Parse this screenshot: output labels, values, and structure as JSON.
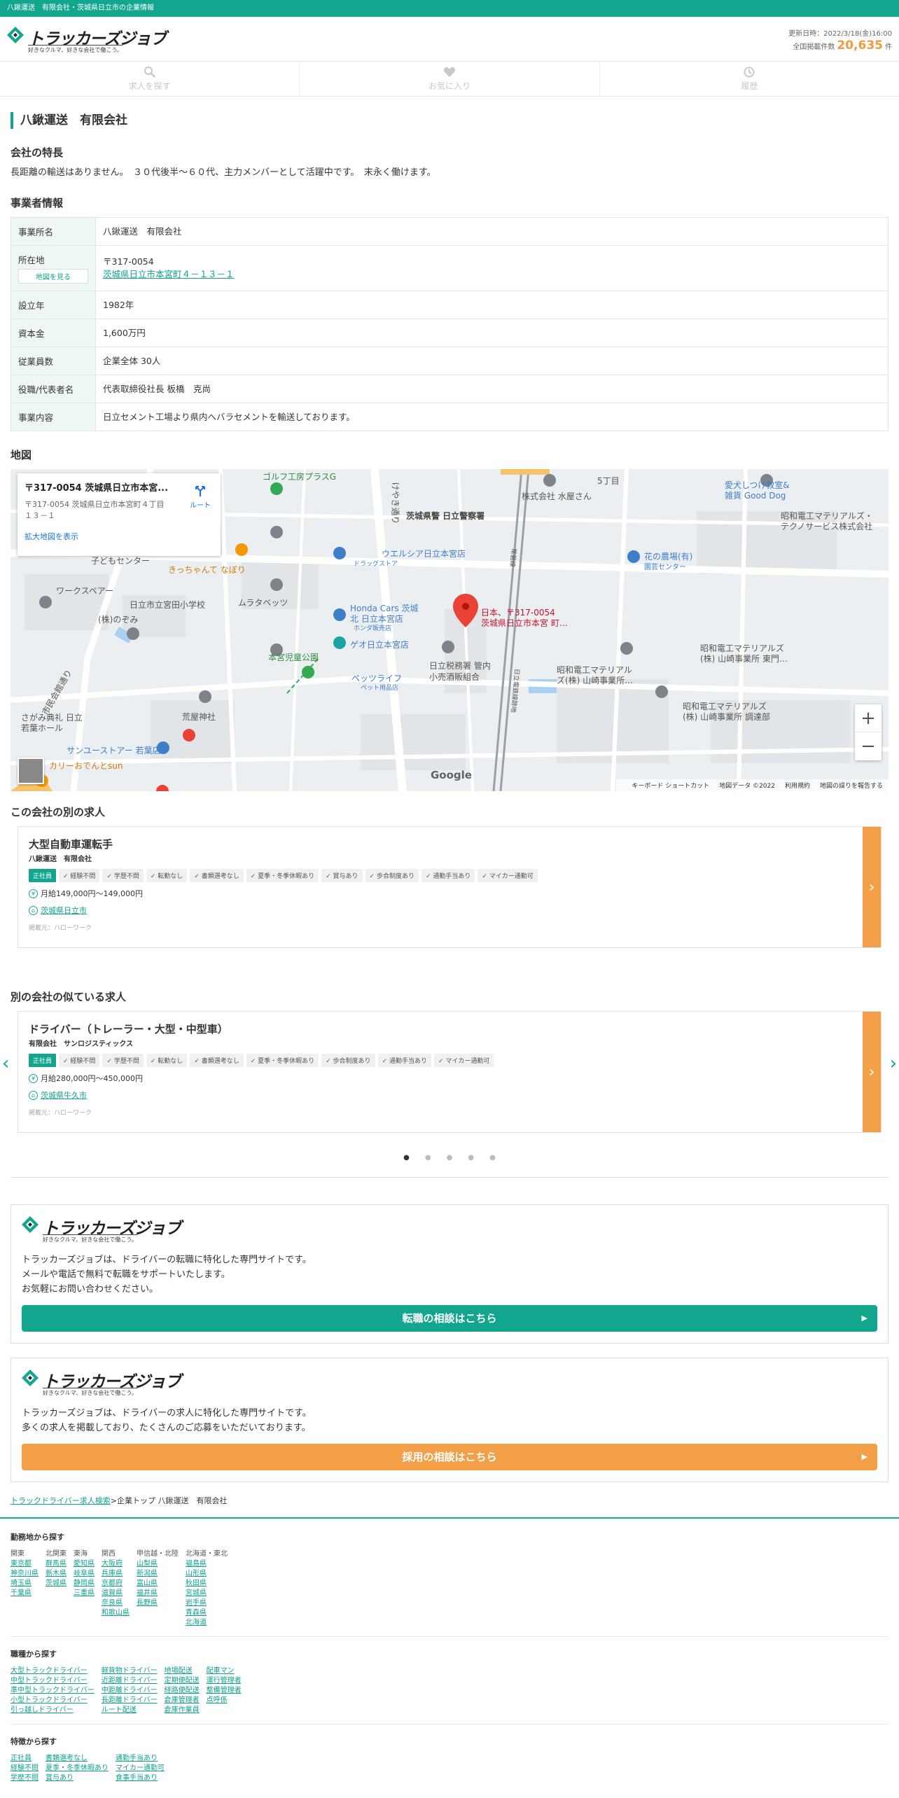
{
  "topbar": {
    "text": "八鍬運送　有限会社・茨城県日立市の企業情報"
  },
  "header": {
    "logo_text": "トラッカーズジョブ",
    "logo_tagline": "好きなクルマ、好きな会社で働こう。",
    "updated": "更新日時：2022/3/18(金)16:00",
    "total_label": "全国掲載件数",
    "total_count": "20,635",
    "total_unit": "件"
  },
  "nav": [
    {
      "label": "求人を探す",
      "icon": "search-icon"
    },
    {
      "label": "お気に入り",
      "icon": "heart-icon"
    },
    {
      "label": "履歴",
      "icon": "history-icon"
    }
  ],
  "page_title": "八鍬運送　有限会社",
  "features": {
    "heading": "会社の特長",
    "text": "長距離の輸送はありません。　３０代後半～６０代、主力メンバーとして活躍中です。　末永く働けます。"
  },
  "business": {
    "heading": "事業者情報",
    "map_button": "地図を見る",
    "rows": [
      {
        "label": "事業所名",
        "value": "八鍬運送　有限会社"
      },
      {
        "label": "所在地",
        "postal": "〒317-0054",
        "address": "茨城県日立市本宮町４－１３－１"
      },
      {
        "label": "設立年",
        "value": "1982年"
      },
      {
        "label": "資本金",
        "value": "1,600万円"
      },
      {
        "label": "従業員数",
        "value": "企業全体 30人"
      },
      {
        "label": "役職/代表者名",
        "value": "代表取締役社長 板橋　克尚"
      },
      {
        "label": "事業内容",
        "value": "日立セメント工場より県内へバラセメントを輸送しております。"
      }
    ]
  },
  "map": {
    "heading": "地図",
    "card_title": "〒317-0054 茨城県日立市本宮...",
    "card_address": "〒317-0054 茨城県日立市本宮町４丁目１３－１",
    "card_route": "ルート",
    "card_link": "拡大地図を表示",
    "pin_label_1": "日本、〒317-0054",
    "pin_label_2": "茨城県日立市本宮 町…",
    "zoom_in": "+",
    "zoom_out": "−",
    "google": "Google",
    "footer": [
      "キーボード ショートカット",
      "地図データ ©2022",
      "利用規約",
      "地図の誤りを報告する"
    ],
    "labels": {
      "golf": "ゴルフ工房プラスG",
      "police": "茨城県警 日立警察署",
      "uelsia": "ウエルシア日立本宮店",
      "drug": "ドラッグストア",
      "kodomo": "子どもセンター",
      "kichan": "きっちゃんて なぼり",
      "workspare": "ワークスペアー",
      "school": "日立市立宮田小学校",
      "muratabeppu": "ムラタベッツ",
      "nozomi": "(株)のぞみ",
      "honda1": "Honda Cars 茨城",
      "honda2": "北 日立本宮店",
      "honda3": "ホンダ販売店",
      "geo": "ゲオ日立本宮店",
      "park": "本宮児童公園",
      "betsu": "ベッツライフ",
      "betsu2": "ペット用品店",
      "zei1": "日立税務署 管内",
      "zei2": "小売酒販組合",
      "shrine": "荒屋神社",
      "sanyu": "サンユーストアー 若葉店",
      "curry": "カリーおでんとsun",
      "sagami1": "さがみ典礼 日立",
      "sagami2": "若葉ホール",
      "road1": "市民会館通り",
      "road2": "けやき通り",
      "mizuho": "株式会社 水屋さん",
      "go": "5丁目",
      "inu1": "愛犬しつけ教室&",
      "inu2": "雑貨 Good Dog",
      "showa1": "昭和電工マテリアルズ・",
      "showa2": "テクノサービス株式会社",
      "hana1": "花の農場(有)",
      "hana2": "園芸センター",
      "sm1": "昭和電工マテリアルズ",
      "sm2": "(株) 山崎事業所 東門…",
      "sm3": "昭和電工マテリアル",
      "sm4": "ズ(株) 山崎事業所…",
      "sm5": "昭和電工マテリアルズ",
      "sm6": "(株) 山崎事業所 調達部",
      "rail": "常磐線",
      "rail2": "日立電鉄線跡地"
    }
  },
  "other_jobs": {
    "heading": "この会社の別の求人",
    "job": {
      "title": "大型自動車運転手",
      "company": "八鍬運送　有限会社",
      "tags": [
        "正社員",
        "経験不問",
        "学歴不問",
        "転勤なし",
        "書類選考なし",
        "夏季・冬季休暇あり",
        "賞与あり",
        "歩合制度あり",
        "通勤手当あり",
        "マイカー通勤可"
      ],
      "salary": "月給149,000円～149,000円",
      "location": "茨城県日立市",
      "source": "掲載元：ハローワーク"
    }
  },
  "similar_jobs": {
    "heading": "別の会社の似ている求人",
    "job": {
      "title": "ドライバー（トレーラー・大型・中型車）",
      "company": "有限会社　サンロジスティックス",
      "tags": [
        "正社員",
        "経験不問",
        "学歴不問",
        "転勤なし",
        "書類選考なし",
        "夏季・冬季休暇あり",
        "歩合制度あり",
        "通勤手当あり",
        "マイカー通勤可"
      ],
      "salary": "月給280,000円～450,000円",
      "location": "茨城県牛久市",
      "source": "掲載元：ハローワーク"
    },
    "dots": 5
  },
  "promo1": {
    "text": [
      "トラッカーズジョブは、ドライバーの転職に特化した専門サイトです。",
      "メールや電話で無料で転職をサポートいたします。",
      "お気軽にお問い合わせください。"
    ],
    "button": "転職の相談はこちら"
  },
  "promo2": {
    "text": [
      "トラッカーズジョブは、ドライバーの求人に特化した専門サイトです。",
      "多くの求人を掲載しており、たくさんのご応募をいただいております。"
    ],
    "button": "採用の相談はこちら"
  },
  "breadcrumb": {
    "link": "トラックドライバー求人検索",
    "rest": ">企業トップ 八鍬運送　有限会社"
  },
  "footer": {
    "area_heading": "勤務地から探す",
    "area_cols": [
      {
        "head": "関東",
        "items": [
          "東京都",
          "神奈川県",
          "埼玉県",
          "千葉県"
        ]
      },
      {
        "head": "北関東",
        "items": [
          "群馬県",
          "栃木県",
          "茨城県"
        ]
      },
      {
        "head": "東海",
        "items": [
          "愛知県",
          "岐阜県",
          "静岡県",
          "三重県"
        ]
      },
      {
        "head": "関西",
        "items": [
          "大阪府",
          "兵庫県",
          "京都府",
          "滋賀県",
          "奈良県",
          "和歌山県"
        ]
      },
      {
        "head": "甲信越・北陸",
        "items": [
          "山梨県",
          "新潟県",
          "富山県",
          "福井県",
          "長野県"
        ]
      },
      {
        "head": "北海道・東北",
        "items": [
          "福島県",
          "山形県",
          "秋田県",
          "宮城県",
          "岩手県",
          "青森県",
          "北海道"
        ]
      }
    ],
    "job_heading": "職種から探す",
    "job_cols": [
      [
        "大型トラックドライバー",
        "中型トラックドライバー",
        "準中型トラックドライバー",
        "小型トラックドライバー",
        "引っ越しドライバー"
      ],
      [
        "軽貨物ドライバー",
        "近距離ドライバー",
        "中距離ドライバー",
        "長距離ドライバー",
        "ルート配送"
      ],
      [
        "地場配送",
        "定期便配送",
        "経路便配送",
        "倉庫管理者",
        "倉庫作業員"
      ],
      [
        "配車マン",
        "運行管理者",
        "整備管理者",
        "点呼係"
      ]
    ],
    "feat_heading": "特徴から探す",
    "feat_cols": [
      [
        "正社員",
        "経験不問",
        "学歴不問"
      ],
      [
        "書類選考なし",
        "夏季・冬季休暇あり",
        "賞与あり"
      ],
      [
        "通勤手当あり",
        "マイカー通勤可",
        "食事手当あり"
      ]
    ]
  }
}
